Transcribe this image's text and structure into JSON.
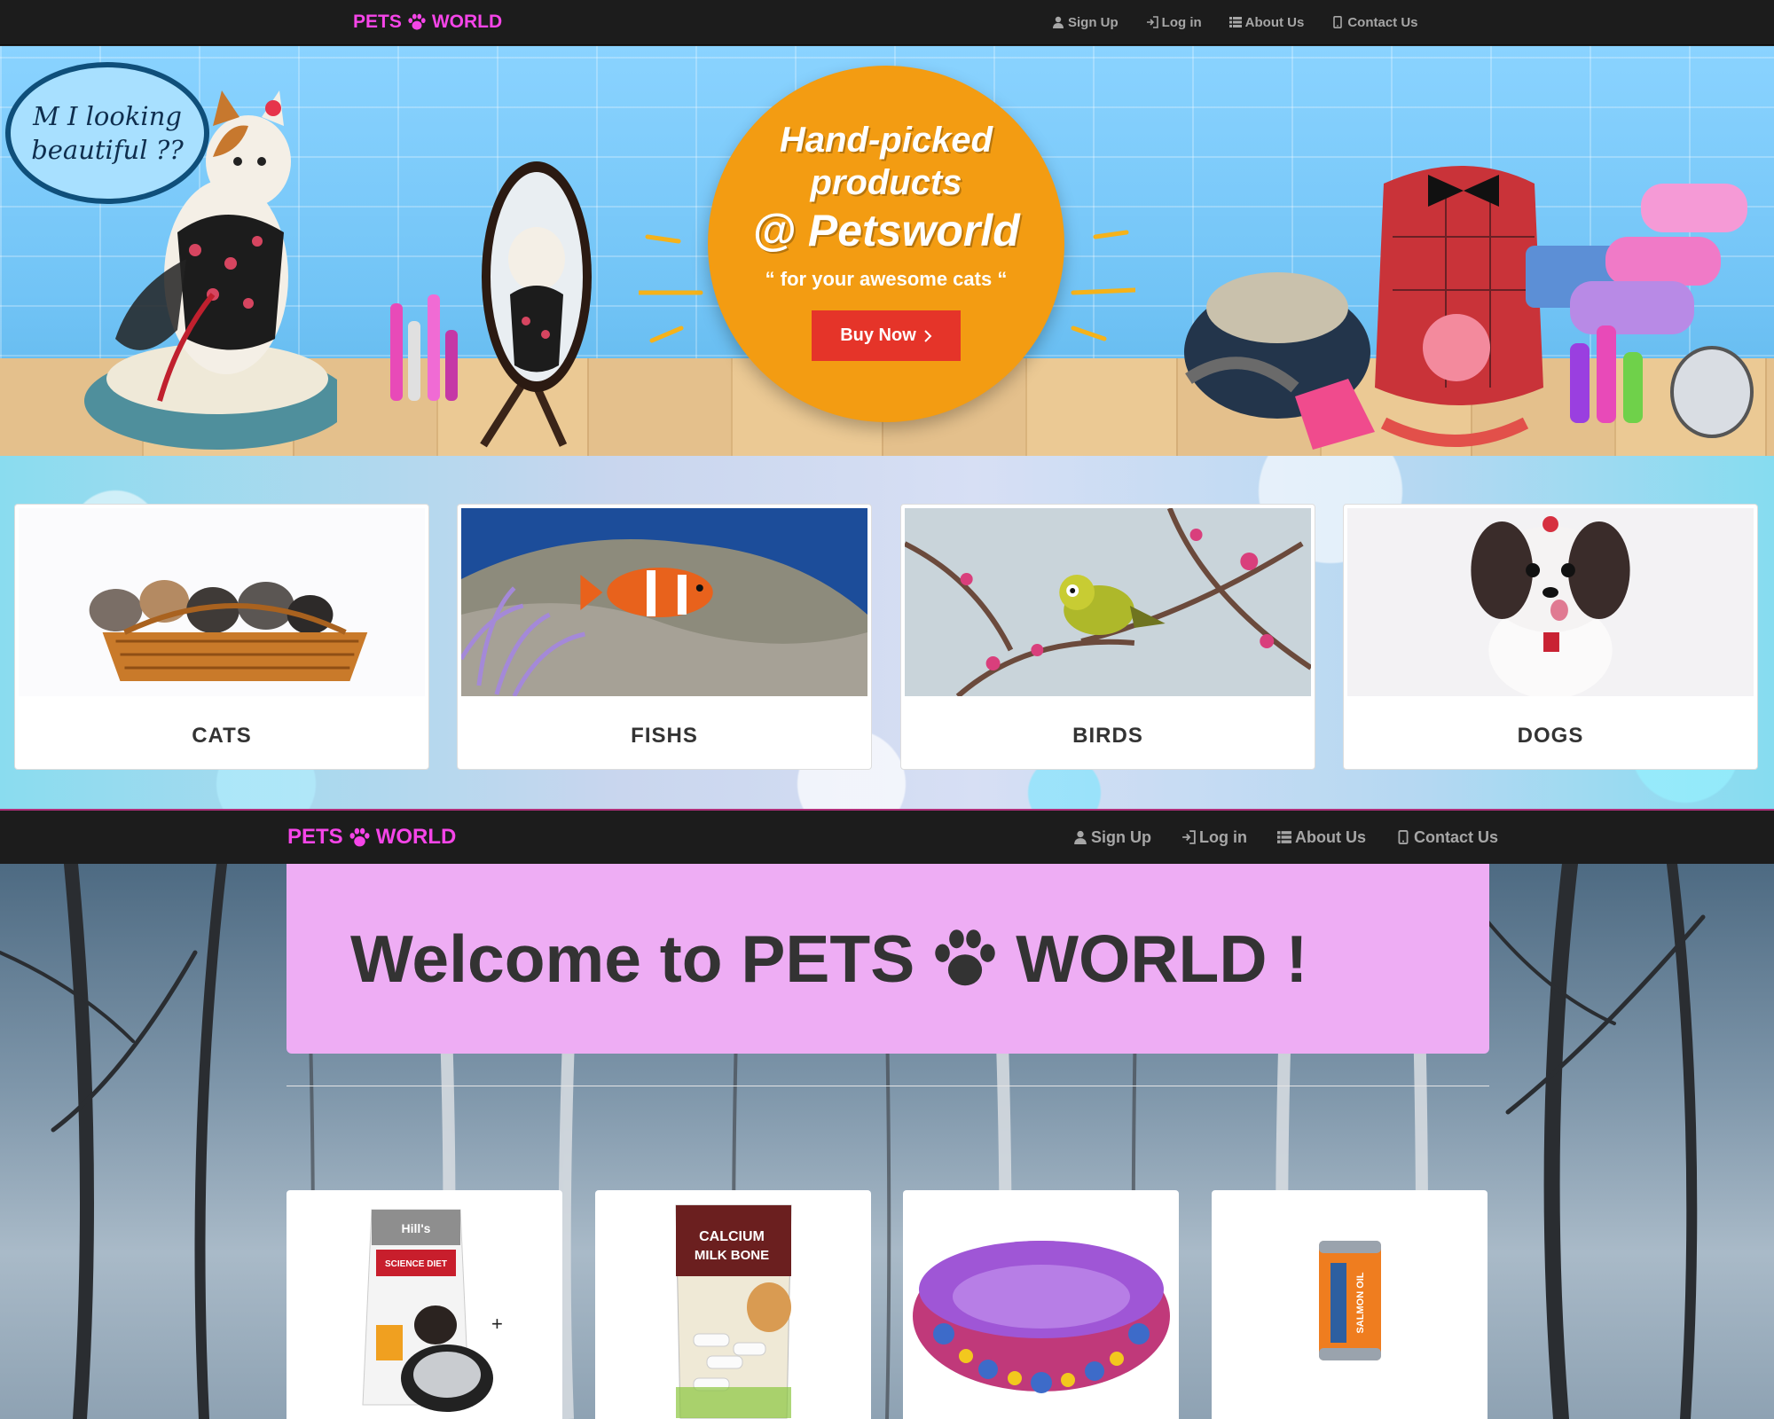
{
  "brand": {
    "name_left": "PETS",
    "name_right": "WORLD"
  },
  "nav": {
    "signup": "Sign Up",
    "login": "Log in",
    "about": "About Us",
    "contact": "Contact Us"
  },
  "hero": {
    "bubble_line1": "M I looking",
    "bubble_line2": "beautiful ??",
    "headline_line1": "Hand-picked",
    "headline_line2": "products",
    "headline_line3": "@ Petsworld",
    "tagline": "“ for your awesome cats “",
    "buy_label": "Buy Now"
  },
  "categories": [
    {
      "label": "CATS"
    },
    {
      "label": "FISHS"
    },
    {
      "label": "BIRDS"
    },
    {
      "label": "DOGS"
    }
  ],
  "welcome": {
    "prefix": "Welcome to PETS",
    "suffix": "WORLD !"
  },
  "products": [
    {
      "label_top": "Hill's",
      "label_main": "SCIENCE DIET"
    },
    {
      "label_top": "CALCIUM",
      "label_main": "MILK BONE"
    },
    {
      "name": "pet-bed"
    },
    {
      "label_main": "SALMON OIL"
    }
  ],
  "colors": {
    "brand": "#f545e8",
    "navbar": "#1c1c1c",
    "jumbotron": "#eeadf4",
    "buy_button": "#e53429",
    "hero_circle": "#f39c12"
  }
}
